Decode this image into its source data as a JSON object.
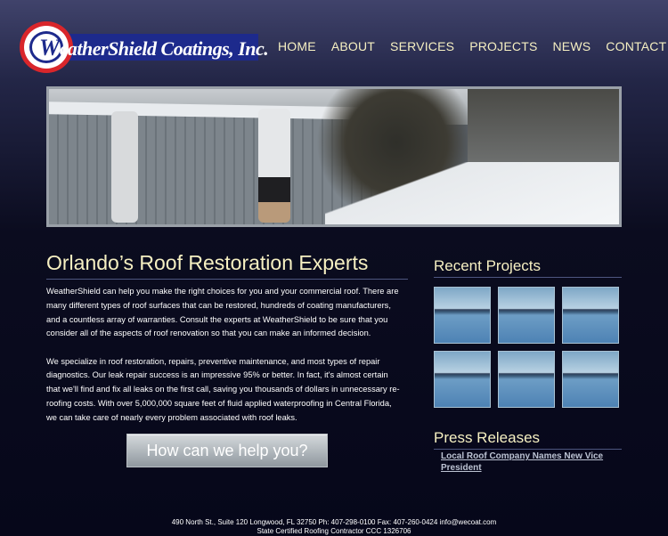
{
  "logo": {
    "text_w": "W",
    "text_rest": "eatherShield Coatings, Inc."
  },
  "nav": [
    "HOME",
    "ABOUT",
    "SERVICES",
    "PROJECTS",
    "NEWS",
    "CONTACT"
  ],
  "main": {
    "title": "Orlando’s Roof Restoration Experts",
    "paragraphs": [
      "WeatherShield can help you make the right choices for you and your commercial roof. There are many different types of roof surfaces that can be restored, hundreds of coating manufacturers, and a countless array of warranties. Consult the experts at WeatherShield to be sure that you consider all of the aspects of roof renovation so that you can make an informed decision.",
      "We specialize in roof restoration, repairs, preventive maintenance, and most types of repair diagnostics. Our leak repair success is an impressive 95% or better. In fact, it's almost certain that we'll find and fix all leaks on the first call, saving you thousands of dollars in unnecessary re-roofing costs. With over 5,000,000 square feet of fluid applied waterproofing in Central Florida, we can take care of nearly every problem associated with roof leaks."
    ],
    "cta": "How can we help you?"
  },
  "sidebar": {
    "recent_projects_title": "Recent Projects",
    "project_thumbs": 6,
    "press_title": "Press Releases",
    "press_items": [
      "Local Roof Company Names New Vice President"
    ]
  },
  "footer": {
    "line1": "490 North St., Suite 120 Longwood, FL 32750 Ph: 407-298-0100 Fax: 407-260-0424 info@wecoat.com",
    "line2": "State Certified Roofing Contractor CCC 1326706"
  }
}
